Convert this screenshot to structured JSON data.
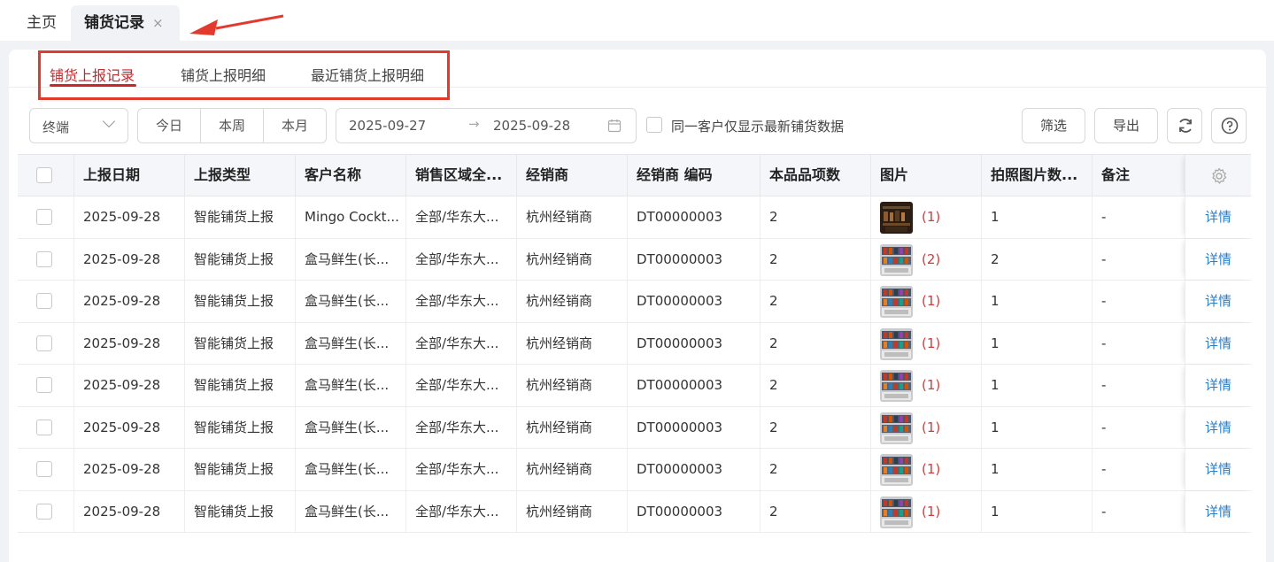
{
  "top_tabs": {
    "home": "主页",
    "active": "铺货记录",
    "close_glyph": "×"
  },
  "sub_tabs": [
    "铺货上报记录",
    "铺货上报明细",
    "最近铺货上报明细"
  ],
  "toolbar": {
    "terminal_select": "终端",
    "quick_ranges": [
      "今日",
      "本周",
      "本月"
    ],
    "date_start": "2025-09-27",
    "date_arrow": "→",
    "date_end": "2025-09-28",
    "latest_only_label": "同一客户仅显示最新铺货数据",
    "filter_label": "筛选",
    "export_label": "导出"
  },
  "table": {
    "columns": [
      "上报日期",
      "上报类型",
      "客户名称",
      "销售区域全...",
      "经销商",
      "经销商 编码",
      "本品品项数",
      "图片",
      "拍照图片数...",
      "备注"
    ],
    "rows": [
      {
        "date": "2025-09-28",
        "type": "智能铺货上报",
        "customer": "Mingo Cockt...",
        "region": "全部/华东大...",
        "dealer": "杭州经销商",
        "dealer_code": "DT00000003",
        "sku_count": "2",
        "pic_count": "(1)",
        "photo_count": "1",
        "remark": "-",
        "action": "详情",
        "thumb": "dark"
      },
      {
        "date": "2025-09-28",
        "type": "智能铺货上报",
        "customer": "盒马鲜生(长...",
        "region": "全部/华东大...",
        "dealer": "杭州经销商",
        "dealer_code": "DT00000003",
        "sku_count": "2",
        "pic_count": "(2)",
        "photo_count": "2",
        "remark": "-",
        "action": "详情",
        "thumb": "shelf"
      },
      {
        "date": "2025-09-28",
        "type": "智能铺货上报",
        "customer": "盒马鲜生(长...",
        "region": "全部/华东大...",
        "dealer": "杭州经销商",
        "dealer_code": "DT00000003",
        "sku_count": "2",
        "pic_count": "(1)",
        "photo_count": "1",
        "remark": "-",
        "action": "详情",
        "thumb": "shelf"
      },
      {
        "date": "2025-09-28",
        "type": "智能铺货上报",
        "customer": "盒马鲜生(长...",
        "region": "全部/华东大...",
        "dealer": "杭州经销商",
        "dealer_code": "DT00000003",
        "sku_count": "2",
        "pic_count": "(1)",
        "photo_count": "1",
        "remark": "-",
        "action": "详情",
        "thumb": "shelf"
      },
      {
        "date": "2025-09-28",
        "type": "智能铺货上报",
        "customer": "盒马鲜生(长...",
        "region": "全部/华东大...",
        "dealer": "杭州经销商",
        "dealer_code": "DT00000003",
        "sku_count": "2",
        "pic_count": "(1)",
        "photo_count": "1",
        "remark": "-",
        "action": "详情",
        "thumb": "shelf"
      },
      {
        "date": "2025-09-28",
        "type": "智能铺货上报",
        "customer": "盒马鲜生(长...",
        "region": "全部/华东大...",
        "dealer": "杭州经销商",
        "dealer_code": "DT00000003",
        "sku_count": "2",
        "pic_count": "(1)",
        "photo_count": "1",
        "remark": "-",
        "action": "详情",
        "thumb": "shelf"
      },
      {
        "date": "2025-09-28",
        "type": "智能铺货上报",
        "customer": "盒马鲜生(长...",
        "region": "全部/华东大...",
        "dealer": "杭州经销商",
        "dealer_code": "DT00000003",
        "sku_count": "2",
        "pic_count": "(1)",
        "photo_count": "1",
        "remark": "-",
        "action": "详情",
        "thumb": "shelf"
      },
      {
        "date": "2025-09-28",
        "type": "智能铺货上报",
        "customer": "盒马鲜生(长...",
        "region": "全部/华东大...",
        "dealer": "杭州经销商",
        "dealer_code": "DT00000003",
        "sku_count": "2",
        "pic_count": "(1)",
        "photo_count": "1",
        "remark": "-",
        "action": "详情",
        "thumb": "shelf"
      }
    ]
  },
  "colors": {
    "accent": "#c7282c",
    "link": "#2a7ec8",
    "count": "#d13b3b",
    "annotation": "#e23b2e"
  },
  "icons": {
    "arrow": "arrow-annotation-icon",
    "calendar": "calendar-icon",
    "refresh": "refresh-icon",
    "help": "help-icon",
    "gear": "gear-icon"
  }
}
